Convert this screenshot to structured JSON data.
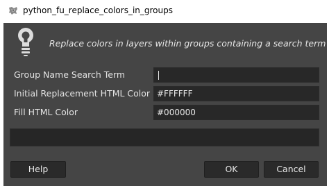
{
  "window": {
    "title": "python_fu_replace_colors_in_groups",
    "icon": "gimp-wilber-icon"
  },
  "header": {
    "icon": "lightbulb-icon",
    "description": "Replace colors in layers within groups containing a search term"
  },
  "fields": [
    {
      "label": "Group Name Search Term",
      "value": ""
    },
    {
      "label": "Initial Replacement HTML Color",
      "value": "#FFFFFF"
    },
    {
      "label": "Fill HTML Color",
      "value": "#000000"
    }
  ],
  "buttons": {
    "help": "Help",
    "ok": "OK",
    "cancel": "Cancel"
  },
  "colors": {
    "dialog_bg": "#454545",
    "input_bg": "#282828",
    "text": "#e3e3e3"
  }
}
